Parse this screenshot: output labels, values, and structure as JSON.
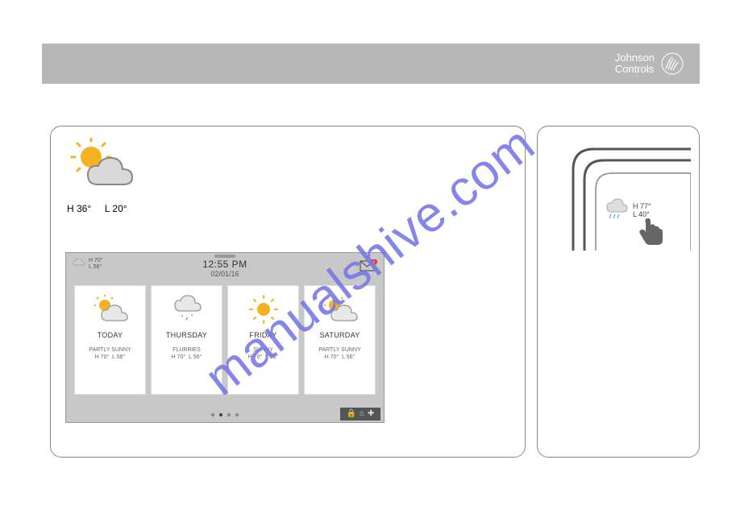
{
  "brand": {
    "line1": "Johnson",
    "line2": "Controls"
  },
  "current": {
    "high_label": "H 36°",
    "low_label": "L 20°"
  },
  "widget": {
    "time": "12:55 PM",
    "date": "02/01/16",
    "mini": {
      "high": "H 70°",
      "low": "L 56°"
    },
    "mail_badge": "2",
    "days": [
      {
        "day": "TODAY",
        "cond": "PARTLY SUNNY",
        "high": "H 70°",
        "low": "L 56°",
        "icon": "partly"
      },
      {
        "day": "THURSDAY",
        "cond": "FLURRIES",
        "high": "H 70°",
        "low": "L 56°",
        "icon": "flurries"
      },
      {
        "day": "FRIDAY",
        "cond": "SUNNY",
        "high": "H 70°",
        "low": "L 56°",
        "icon": "sunny"
      },
      {
        "day": "SATURDAY",
        "cond": "PARTLY SUNNY",
        "high": "H 70°",
        "low": "L 56°",
        "icon": "partly"
      }
    ]
  },
  "touch": {
    "high": "H 77°",
    "low": "L 40°"
  },
  "watermark": "manualshive.com"
}
